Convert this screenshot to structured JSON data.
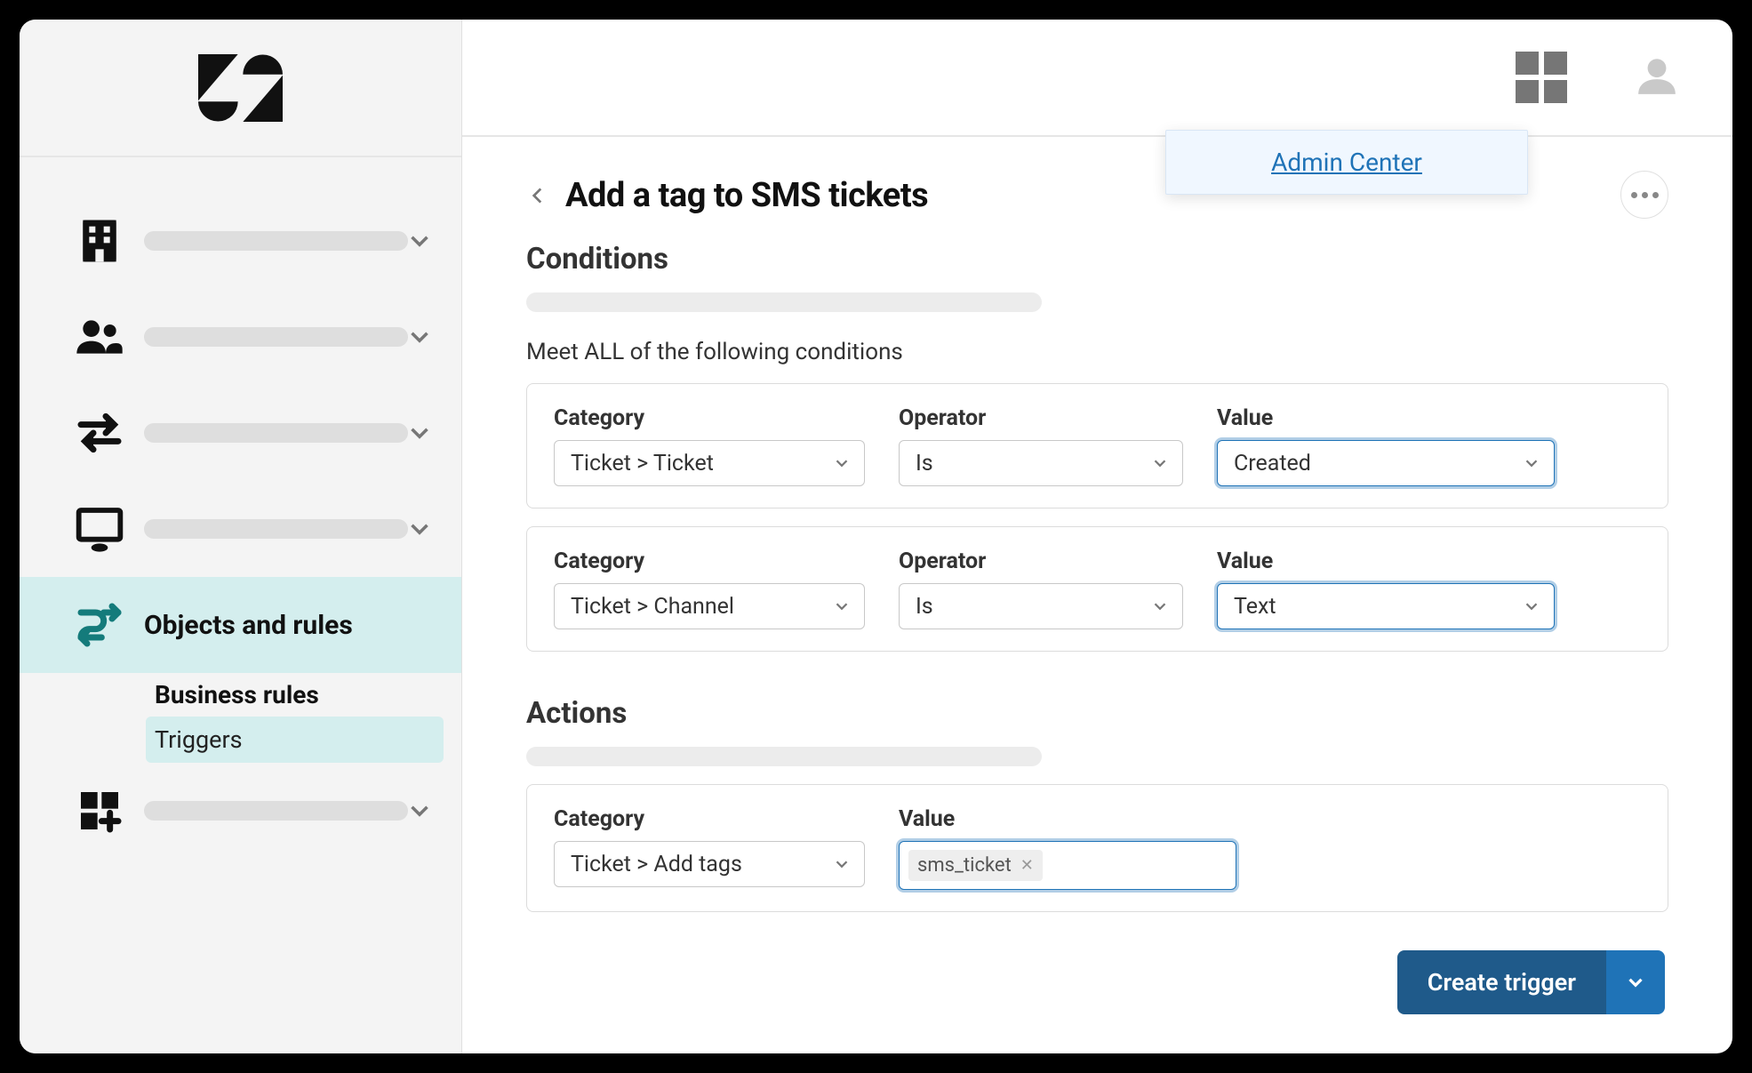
{
  "header": {
    "dropdown_link": "Admin Center"
  },
  "page": {
    "title": "Add a tag to SMS tickets",
    "create_button": "Create trigger"
  },
  "sidebar": {
    "selected_label": "Objects and rules",
    "subgroup_heading": "Business rules",
    "subgroup_item_active": "Triggers"
  },
  "conditions": {
    "title": "Conditions",
    "meet_all": "Meet ALL of the following conditions",
    "labels": {
      "category": "Category",
      "operator": "Operator",
      "value": "Value"
    },
    "rows": [
      {
        "category": "Ticket > Ticket",
        "operator": "Is",
        "value": "Created"
      },
      {
        "category": "Ticket > Channel",
        "operator": "Is",
        "value": "Text"
      }
    ]
  },
  "actions": {
    "title": "Actions",
    "labels": {
      "category": "Category",
      "value": "Value"
    },
    "rows": [
      {
        "category": "Ticket > Add tags",
        "value_tag": "sms_ticket"
      }
    ]
  }
}
